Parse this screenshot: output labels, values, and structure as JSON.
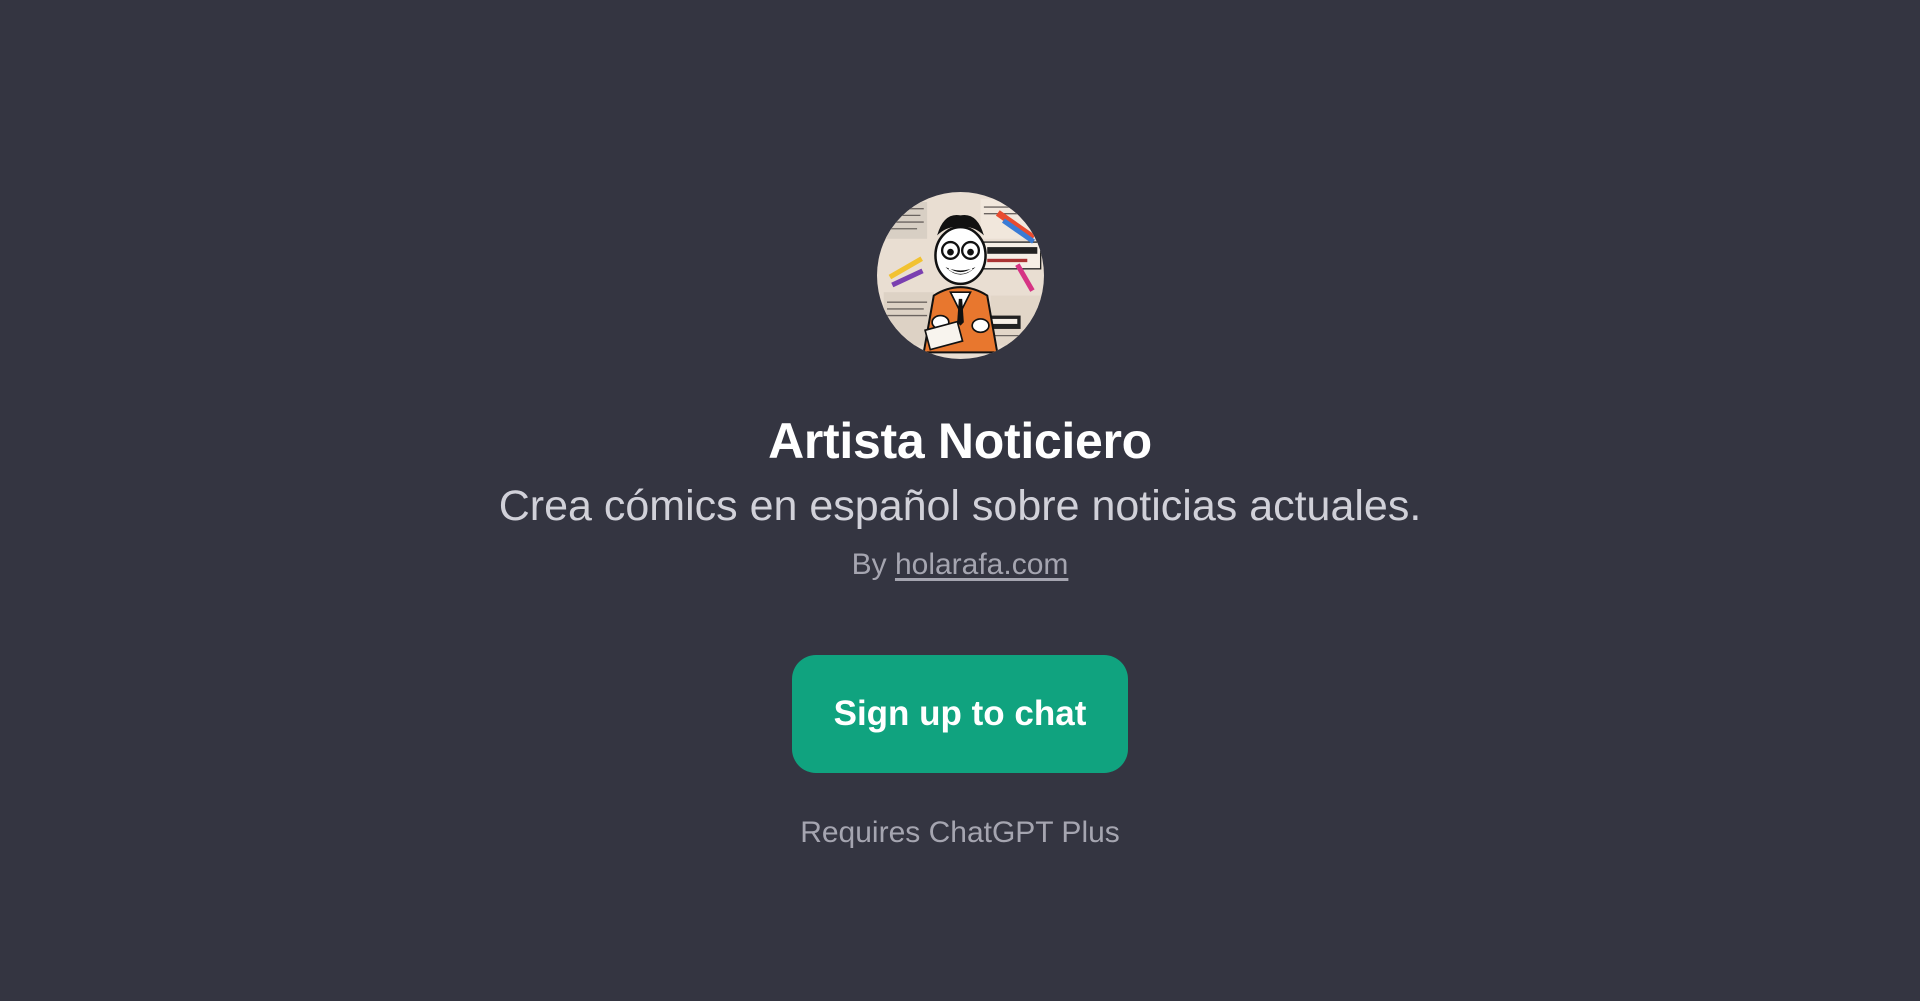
{
  "gpt": {
    "avatar_icon": "comic-artist-avatar",
    "name": "Artista Noticiero",
    "description": "Crea cómics en español sobre noticias actuales.",
    "byline_prefix": "By",
    "author_link": "holarafa.com"
  },
  "cta": {
    "label": "Sign up to chat",
    "color": "#10a37f"
  },
  "footer": {
    "requirement": "Requires ChatGPT Plus"
  },
  "theme": {
    "background": "#343541"
  }
}
